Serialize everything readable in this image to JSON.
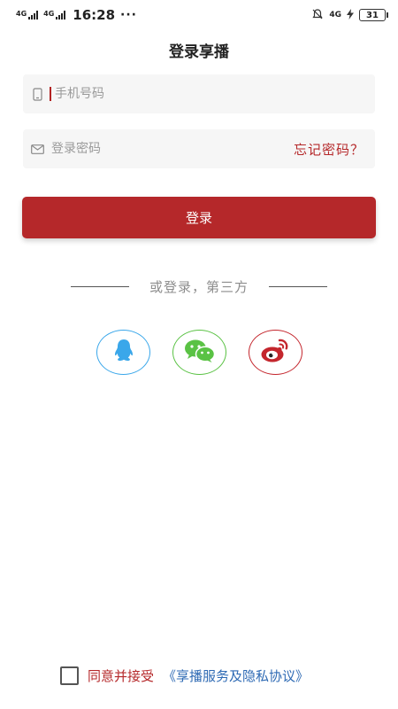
{
  "status_bar": {
    "net1": "4G",
    "net2": "4G",
    "time": "16:28",
    "dots": "···",
    "right_net": "4G",
    "battery": "31"
  },
  "page": {
    "title": "登录享播"
  },
  "form": {
    "phone_placeholder": "手机号码",
    "password_placeholder": "登录密码",
    "forgot_label": "忘记密码？",
    "login_label": "登录"
  },
  "divider": {
    "text": "或登录，第三方"
  },
  "social": {
    "items": [
      {
        "name": "qq",
        "icon": "qq-icon",
        "color": "#3aa7ea"
      },
      {
        "name": "wechat",
        "icon": "wechat-icon",
        "color": "#5ac244"
      },
      {
        "name": "weibo",
        "icon": "weibo-icon",
        "color": "#c4262d"
      }
    ]
  },
  "agreement": {
    "label": "同意并接受",
    "link": "《享播服务及隐私协议》"
  },
  "colors": {
    "primary": "#b5282a",
    "link": "#2e6ab4",
    "field_bg": "#f6f6f6"
  }
}
